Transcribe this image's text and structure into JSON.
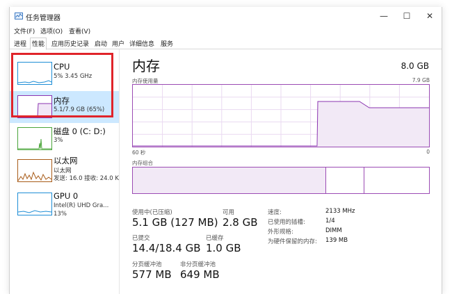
{
  "window": {
    "title": "任务管理器",
    "controls": [
      "—",
      "☐",
      "✕"
    ]
  },
  "menu": [
    "文件(F)",
    "选项(O)",
    "查看(V)"
  ],
  "tabs": [
    "进程",
    "性能",
    "应用历史记录",
    "启动",
    "用户",
    "详细信息",
    "服务"
  ],
  "active_tab": "性能",
  "sidebar": {
    "items": [
      {
        "name": "CPU",
        "line1": "5% 3.45 GHz",
        "line2": "",
        "color": "#1d8dd6"
      },
      {
        "name": "内存",
        "line1": "5.1/7.9 GB (65%)",
        "line2": "",
        "color": "#8b34b0"
      },
      {
        "name": "磁盘 0 (C: D:)",
        "line1": "3%",
        "line2": "",
        "color": "#4aa53a"
      },
      {
        "name": "以太网",
        "line1": "以太网",
        "line2": "发送: 16.0  接收: 24.0 K",
        "color": "#a85b18"
      },
      {
        "name": "GPU 0",
        "line1": "Intel(R) UHD Gra...",
        "line2": "13%",
        "color": "#1d8dd6"
      }
    ]
  },
  "main": {
    "title": "内存",
    "total": "8.0 GB",
    "usage_label": "内存使用量",
    "usage_max": "7.9 GB",
    "axis_left": "60 秒",
    "axis_right": "0",
    "composition_label": "内存组合",
    "memory_usage_fraction_percent": 65,
    "stats": {
      "in_use_label": "使用中(已压缩)",
      "in_use_value": "5.1 GB (127 MB)",
      "available_label": "可用",
      "available_value": "2.8 GB",
      "committed_label": "已提交",
      "committed_value": "14.4/18.4 GB",
      "cached_label": "已缓存",
      "cached_value": "1.0 GB",
      "paged_label": "分页缓冲池",
      "paged_value": "577 MB",
      "nonpaged_label": "非分页缓冲池",
      "nonpaged_value": "649 MB"
    },
    "details": [
      {
        "key": "速度:",
        "value": "2133 MHz"
      },
      {
        "key": "已使用的插槽:",
        "value": "1/4"
      },
      {
        "key": "外形规格:",
        "value": "DIMM"
      },
      {
        "key": "为硬件保留的内存:",
        "value": "139 MB"
      }
    ]
  },
  "colors": {
    "accent_memory": "#8b34b0",
    "selection": "#cce8ff",
    "highlight": "#e0242a"
  }
}
